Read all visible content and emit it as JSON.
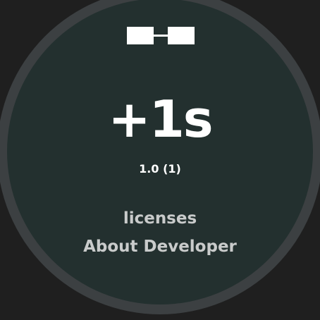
{
  "app": {
    "logo_icon": "dumbbell-icon",
    "title": "+1s",
    "version": "1.0 (1)"
  },
  "menu": {
    "licenses_label": "licenses",
    "about_label": "About Developer"
  },
  "colors": {
    "background": "#1f1f1f",
    "bezel": "#3b3f41",
    "face": "#23302f",
    "text_primary": "#ffffff",
    "text_secondary": "#c9cbcb"
  }
}
